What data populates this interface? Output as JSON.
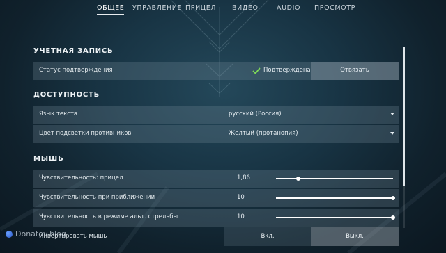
{
  "nav": {
    "tabs": [
      {
        "label": "ОБЩЕЕ",
        "active": true
      },
      {
        "label": "УПРАВЛЕНИЕ",
        "active": false
      },
      {
        "label": "ПРИЦЕЛ",
        "active": false
      },
      {
        "label": "ВИДЕО",
        "active": false
      },
      {
        "label": "AUDIO",
        "active": false
      },
      {
        "label": "ПРОСМОТР",
        "active": false
      }
    ]
  },
  "account": {
    "title": "УЧЕТНАЯ ЗАПИСЬ",
    "status_label": "Статус подтверждения",
    "status_value": "Подтверждена",
    "unbind_label": "Отвязать"
  },
  "accessibility": {
    "title": "ДОСТУПНОСТЬ",
    "text_language_label": "Язык текста",
    "text_language_value": "русский (Россия)",
    "enemy_highlight_label": "Цвет подсветки противников",
    "enemy_highlight_value": "Желтый (протанопия)"
  },
  "mouse": {
    "title": "МЫШЬ",
    "sensitivity_aim_label": "Чувствительность: прицел",
    "sensitivity_aim_value": "1,86",
    "sensitivity_aim_fraction": 0.19,
    "sensitivity_zoom_label": "Чувствительность при приближении",
    "sensitivity_zoom_value": "10",
    "sensitivity_zoom_fraction": 1.0,
    "sensitivity_alt_label": "Чувствительность в режиме альт. стрельбы",
    "sensitivity_alt_value": "10",
    "sensitivity_alt_fraction": 1.0,
    "invert_label": "Инвертировать мышь",
    "invert_on_label": "Вкл.",
    "invert_off_label": "Выкл.",
    "invert_selected": "Выкл."
  },
  "watermark": {
    "text": "Donatov.blog"
  },
  "colors": {
    "accent_check": "#7ed957",
    "background_dark": "#10212c"
  }
}
